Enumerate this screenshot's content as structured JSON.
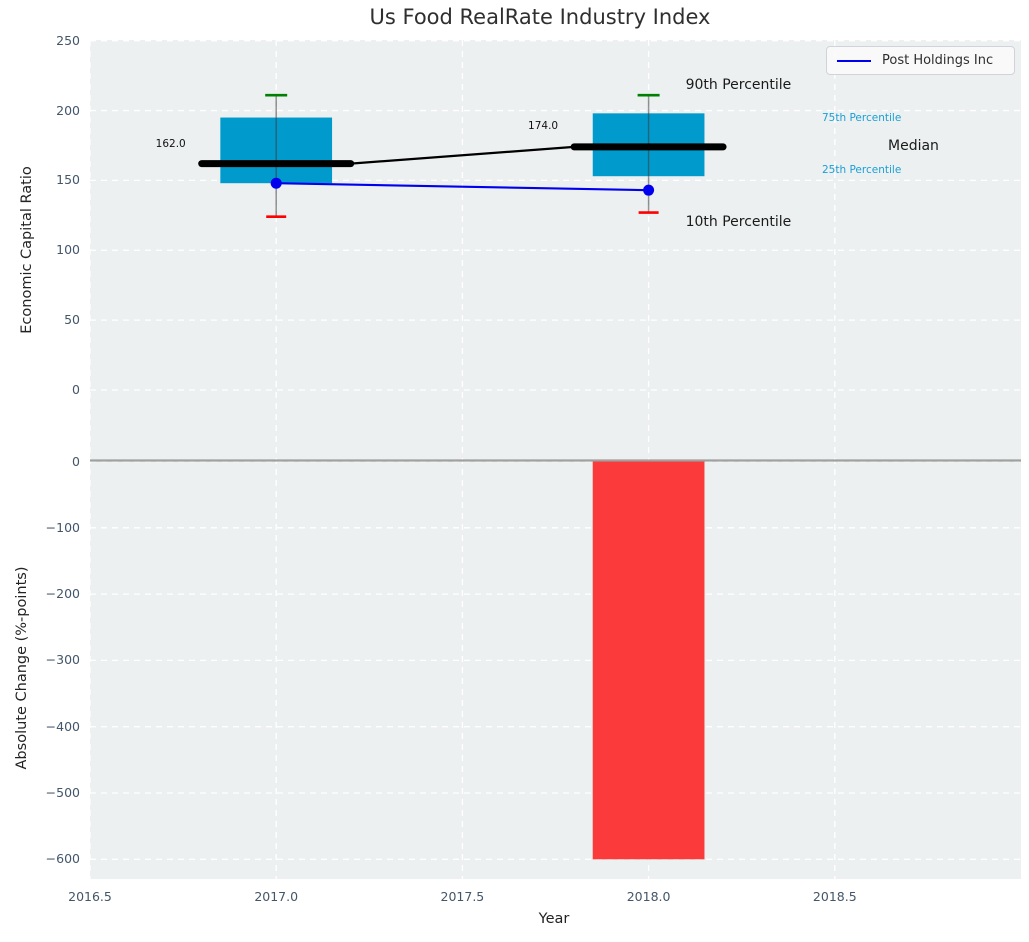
{
  "title": "Us Food RealRate Industry Index",
  "legend": {
    "label": "Post Holdings Inc",
    "position": "upper right"
  },
  "colors": {
    "axes_background": "#edf0f1",
    "grid": "#ffffff",
    "tick_label": "#43566a",
    "box": "#009acd",
    "percentile_text": "#1a9fd4",
    "company_line": "#0000ee",
    "median_line": "#000000",
    "p90_cap": "#007f00",
    "p10_cap": "#ff0000",
    "bar_negative": "#fb3b3b",
    "zero_line": "#a0a0a0"
  },
  "chart_data": [
    {
      "type": "box-line",
      "title": "Us Food RealRate Industry Index",
      "ylabel": "Economic Capital Ratio",
      "xlabel": "",
      "xlim": [
        2016.5,
        2019.0
      ],
      "ylim": [
        -48.7,
        250.5
      ],
      "xtick_labels": [
        "2016.5",
        "2017.0",
        "2017.5",
        "2018.0",
        "2018.5"
      ],
      "xtick_values": [
        2016.5,
        2017.0,
        2017.5,
        2018.0,
        2018.5
      ],
      "yticks": [
        250,
        200,
        150,
        100,
        50,
        0
      ],
      "grid": "white dashed, on",
      "legend_position": "upper right",
      "series": [
        {
          "name": "Post Holdings Inc",
          "color": "#0000ee",
          "x": [
            2017,
            2018
          ],
          "values": [
            148,
            143
          ]
        }
      ],
      "boxes": [
        {
          "year": 2017,
          "p90": 211,
          "p75": 195,
          "median": 162,
          "p25": 148,
          "p10": 124,
          "median_label": "162.0",
          "box_width_years": 0.3
        },
        {
          "year": 2018,
          "p90": 211,
          "p75": 198,
          "median": 174,
          "p25": 153,
          "p10": 127,
          "median_label": "174.0",
          "box_width_years": 0.3
        }
      ],
      "annotations": {
        "p90": "90th Percentile",
        "p75": "75th Percentile",
        "median": "Median",
        "p25": "25th Percentile",
        "p10": "10th Percentile"
      }
    },
    {
      "type": "bar",
      "ylabel": "Absolute Change (%-points)",
      "xlabel": "Year",
      "xlim": [
        2016.5,
        2019.0
      ],
      "ylim": [
        -629.7,
        5.3
      ],
      "yticks": [
        0,
        -100,
        -200,
        -300,
        -400,
        -500,
        -600
      ],
      "xtick_labels": [
        "2016.5",
        "2017.0",
        "2017.5",
        "2018.0",
        "2018.5"
      ],
      "xtick_values": [
        2016.5,
        2017.0,
        2017.5,
        2018.0,
        2018.5
      ],
      "grid": "white dashed, on",
      "bars": [
        {
          "year": 2018,
          "value": -600,
          "width_years": 0.3,
          "color": "#fb3b3b"
        }
      ]
    }
  ]
}
